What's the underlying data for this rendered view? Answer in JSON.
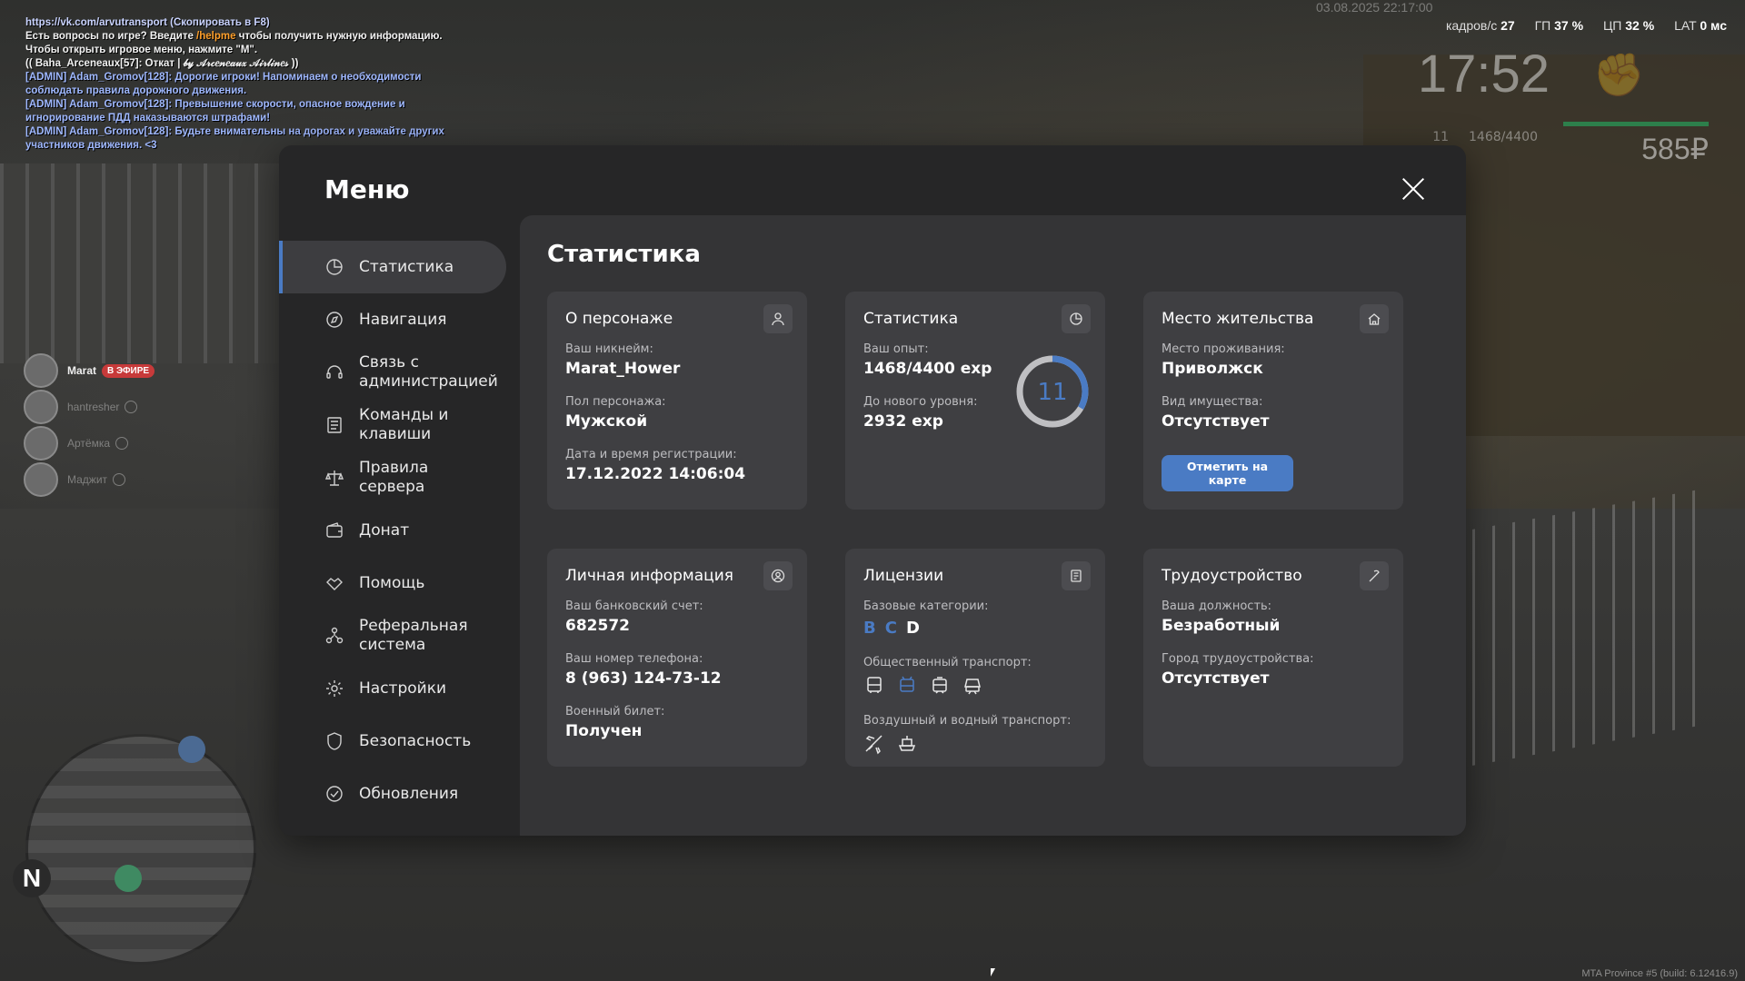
{
  "chat": [
    {
      "cls": "c-link",
      "text": "https://vk.com/arvutransport (Скопировать в F8)"
    },
    {
      "cls": "c-white",
      "parts": [
        {
          "cls": "c-white",
          "text": "Есть вопросы по игре? Введите "
        },
        {
          "cls": "c-orange",
          "text": "/helpme"
        },
        {
          "cls": "c-white",
          "text": " чтобы получить нужную информацию."
        }
      ]
    },
    {
      "cls": "c-white",
      "text": "Чтобы открыть игровое меню, нажмите \"M\"."
    },
    {
      "cls": "c-white",
      "text": "(( Baha_Arceneaux[57]: Откат | 𝒷𝓎 𝒜𝓇𝒸𝑒𝓃𝑒𝒶𝓊𝓍 𝒜𝒾𝓇𝓁𝒾𝓃𝑒𝓈 ))"
    },
    {
      "cls": "c-admin",
      "text": "[ADMIN] Adam_Gromov[128]: Дорогие игроки! Напоминаем о необходимости соблюдать правила дорожного движения."
    },
    {
      "cls": "c-admin",
      "text": "[ADMIN] Adam_Gromov[128]: Превышение скорости, опасное вождение и игнорирование ПДД наказываются штрафами!"
    },
    {
      "cls": "c-admin",
      "text": "[ADMIN] Adam_Gromov[128]: Будьте внимательны на дорогах и уважайте других участников движения. <3"
    }
  ],
  "hud": {
    "date": "03.08.2025 22:17:00",
    "fps_label": "кадров/с",
    "fps": "27",
    "gpu_label": "ГП",
    "gpu": "37 %",
    "cpu_label": "ЦП",
    "cpu": "32 %",
    "lat_label": "LAT",
    "lat": "0 мс",
    "time": "17:52",
    "level": "11",
    "exp": "1468/4400",
    "money": "585₽"
  },
  "voice": [
    {
      "name": "Marat",
      "badge": "В ЭФИРЕ",
      "dim": false
    },
    {
      "name": "hantresher",
      "dim": true
    },
    {
      "name": "Артёмка",
      "dim": true
    },
    {
      "name": "Маджит",
      "dim": true
    }
  ],
  "minimap": {
    "north": "N"
  },
  "build_info": "MTA Province #5 (build: 6.12416.9)",
  "menu": {
    "title": "Меню",
    "nav": [
      {
        "label": "Статистика",
        "icon": "pie-chart-icon",
        "active": true
      },
      {
        "label": "Навигация",
        "icon": "compass-icon"
      },
      {
        "label": "Связь с администрацией",
        "icon": "headset-icon"
      },
      {
        "label": "Команды и клавиши",
        "icon": "list-icon"
      },
      {
        "label": "Правила сервера",
        "icon": "scales-icon"
      },
      {
        "label": "Донат",
        "icon": "wallet-icon"
      },
      {
        "label": "Помощь",
        "icon": "handshake-icon"
      },
      {
        "label": "Реферальная система",
        "icon": "referral-icon"
      },
      {
        "label": "Настройки",
        "icon": "gear-icon"
      },
      {
        "label": "Безопасность",
        "icon": "shield-icon"
      },
      {
        "label": "Обновления",
        "icon": "check-circle-icon"
      }
    ]
  },
  "stats": {
    "title": "Статистика",
    "character": {
      "title": "О персонаже",
      "icon": "user-icon",
      "nick_label": "Ваш никнейм:",
      "nick": "Marat_Hower",
      "sex_label": "Пол персонажа:",
      "sex": "Мужской",
      "reg_label": "Дата и время регистрации:",
      "reg": "17.12.2022 14:06:04"
    },
    "statistics": {
      "title": "Статистика",
      "icon": "pie-chart-icon",
      "exp_label": "Ваш опыт:",
      "exp": "1468/4400 exp",
      "next_label": "До нового уровня:",
      "next": "2932 exp",
      "level": "11",
      "progress": 0.3336
    },
    "residence": {
      "title": "Место жительства",
      "icon": "house-icon",
      "place_label": "Место проживания:",
      "place": "Приволжск",
      "property_label": "Вид имущества:",
      "property": "Отсутствует",
      "button": "Отметить на карте"
    },
    "personal": {
      "title": "Личная информация",
      "icon": "user-circle-icon",
      "bank_label": "Ваш банковский счет:",
      "bank": "682572",
      "phone_label": "Ваш номер телефона:",
      "phone": "8 (963) 124-73-12",
      "military_label": "Военный билет:",
      "military": "Получен"
    },
    "licenses": {
      "title": "Лицензии",
      "icon": "document-icon",
      "base_label": "Базовые категории:",
      "categories": [
        {
          "name": "B",
          "has": true
        },
        {
          "name": "C",
          "has": true
        },
        {
          "name": "D",
          "has": false
        }
      ],
      "public_label": "Общественный транспорт:",
      "public": [
        {
          "icon": "bus-icon",
          "has": false
        },
        {
          "icon": "trolleybus-icon",
          "has": true
        },
        {
          "icon": "tram-icon",
          "has": false
        },
        {
          "icon": "train-icon",
          "has": false
        }
      ],
      "air_label": "Воздушный и водный транспорт:",
      "air": [
        {
          "icon": "plane-icon",
          "has": false
        },
        {
          "icon": "boat-icon",
          "has": false
        }
      ]
    },
    "job": {
      "title": "Трудоустройство",
      "icon": "hammer-icon",
      "position_label": "Ваша должность:",
      "position": "Безработный",
      "city_label": "Город трудоустройства:",
      "city": "Отсутствует"
    },
    "colors": {
      "accent": "#4a7bc4",
      "card": "#3f3f42",
      "panel": "#343436",
      "modal": "#262627"
    }
  }
}
